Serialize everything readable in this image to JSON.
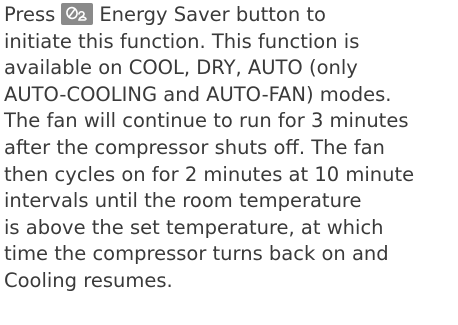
{
  "paragraph": {
    "line1_before_icon": "Press",
    "line1_after_icon": "Energy Saver button to",
    "line2": "initiate this function. This function is",
    "line3": "available on COOL, DRY, AUTO (only",
    "line4": "AUTO-COOLING and AUTO-FAN) modes.",
    "line5": "The fan will continue to run for 3 minutes",
    "line6": "after the compressor shuts off. The fan",
    "line7": "then cycles on for 2 minutes at 10 minute",
    "line8": "intervals until the room temperature",
    "line9": "is above the set temperature, at which",
    "line10": "time the compressor turns back on and",
    "line11": "Cooling resumes."
  },
  "icons": {
    "energy_saver": "energy-saver-icon"
  },
  "colors": {
    "text": "#3a3a3a",
    "icon_background": "#8a8a8a",
    "icon_glyph": "#ffffff"
  }
}
